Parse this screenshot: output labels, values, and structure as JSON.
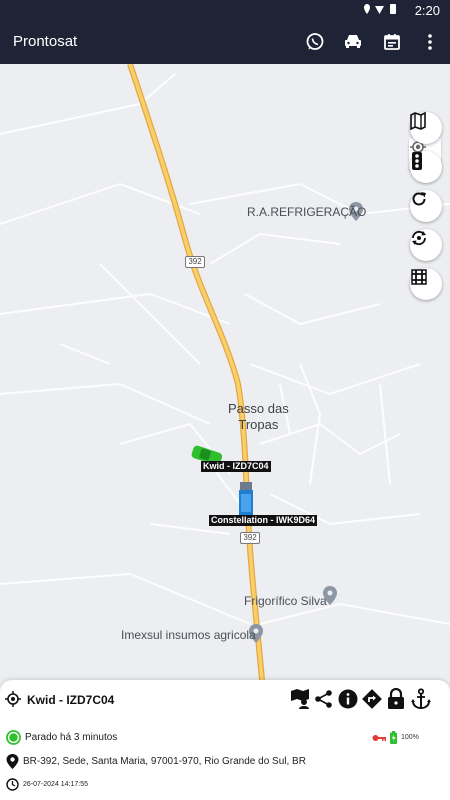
{
  "status_bar": {
    "time": "2:20"
  },
  "app_bar": {
    "title": "Prontosat",
    "icons": [
      "whatsapp-icon",
      "car-icon",
      "calendar-icon",
      "more-vert-icon"
    ]
  },
  "map": {
    "places": {
      "refrigeracao": "R.A.REFRIGERAÇÃO",
      "town_line1": "Passo das",
      "town_line2": "Tropas",
      "frigorifico": "Frigorífico Silva",
      "imexsul": "Imexsul insumos agricola"
    },
    "route_badges": [
      "392",
      "392"
    ],
    "vehicles": [
      {
        "label": "Kwid - IZD7C04",
        "color": "#2fbf2f"
      },
      {
        "label": "Constellation - IWK9D64",
        "color": "#1f7fd0"
      }
    ],
    "controls": [
      "map-layers-icon",
      "traffic-icon",
      "refresh-icon",
      "rotate-icon",
      "grid-icon"
    ]
  },
  "panel": {
    "vehicle_name": "Kwid - IZD7C04",
    "status": "Parado há 3 minutos",
    "address": "BR-392, Sede, Santa Maria, 97001-970, Rio Grande do Sul, BR",
    "timestamp": "26-07-2024 14:17:55",
    "battery": "100%",
    "action_icons": [
      "map-pin-person-icon",
      "share-icon",
      "info-icon",
      "directions-icon",
      "lock-icon",
      "anchor-icon"
    ]
  },
  "colors": {
    "appbar": "#1e2436",
    "road": "#f2b84b",
    "status_ok": "#2fbf2f",
    "key": "#e53935"
  }
}
